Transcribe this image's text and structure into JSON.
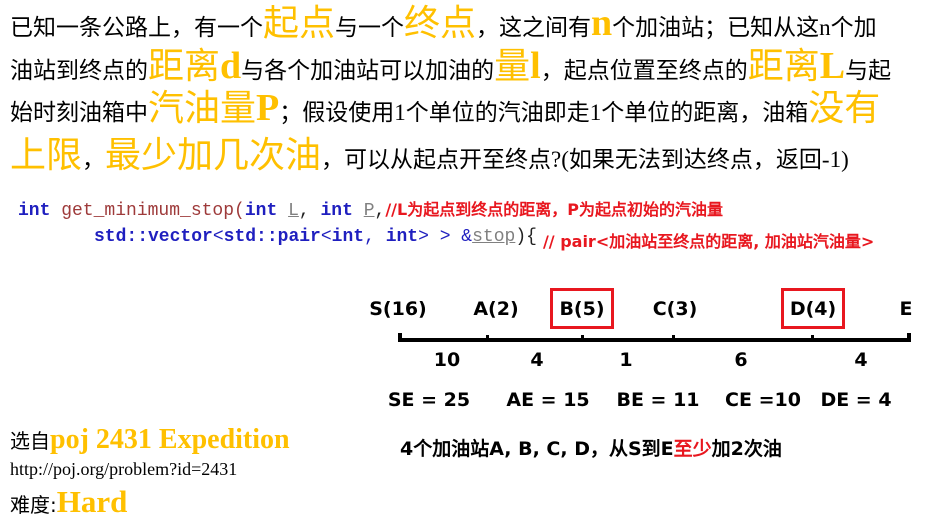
{
  "colors": {
    "highlight": "#FFC000",
    "red": "#E8171F",
    "keyword": "#1F1FBF",
    "function": "#9E3A3A",
    "param": "#808080"
  },
  "intro": {
    "lines": [
      [
        "已知一条公路上，有一个",
        "起点",
        "与一个",
        "终点",
        "，这之间有",
        "n",
        "个加油站；已知从这",
        "n",
        "个加"
      ],
      [
        "油站到终点的",
        "距离",
        "d",
        "与各个加油站可以加油的",
        "量",
        "l",
        "，起点位置至终点的",
        "距离",
        "L",
        "与起"
      ],
      [
        "始时刻油箱中",
        "汽油量",
        "P",
        "；假设使用",
        "1",
        "个单位的汽油即走",
        "1",
        "个单位的距离，油箱",
        "没有"
      ],
      [
        "上限",
        "，",
        "最少加几次油",
        "，可以从起点开至终点",
        "?(",
        "如果无法到达终点，返回",
        "-1)"
      ]
    ]
  },
  "code": {
    "lines": [
      {
        "tokens": [
          "int",
          " get_minimum_stop(",
          "int",
          " ",
          "L",
          ", ",
          "int",
          " ",
          "P",
          ","
        ],
        "comment": "//L为起点到终点的距离，P为起点初始的汽油量"
      },
      {
        "tokens": [
          "std::vector",
          "<",
          "std::pair",
          "<",
          "int",
          ", ",
          "int",
          "> > &",
          "stop",
          "){"
        ],
        "comment": "// pair<加油站至终点的距离, 加油站汽油量>"
      }
    ]
  },
  "diagram": {
    "stations": [
      {
        "label": "S(16)",
        "highlighted": false
      },
      {
        "label": "A(2)",
        "highlighted": false
      },
      {
        "label": "B(5)",
        "highlighted": true
      },
      {
        "label": "C(3)",
        "highlighted": false
      },
      {
        "label": "D(4)",
        "highlighted": true
      },
      {
        "label": "E",
        "highlighted": false
      }
    ],
    "segment_distances": [
      "10",
      "4",
      "1",
      "6",
      "4"
    ],
    "distances_to_end": [
      "SE = 25",
      "AE = 15",
      "BE = 11",
      "CE =10",
      "DE = 4"
    ],
    "conclusion": [
      "4个加油站A, B, C, D，从S到E",
      "至少",
      "加2次油"
    ]
  },
  "source": {
    "prefix": "选自 ",
    "title": "poj 2431 Expedition",
    "url": "http://poj.org/problem?id=2431",
    "difficulty_label": "难度:",
    "difficulty": "Hard"
  }
}
